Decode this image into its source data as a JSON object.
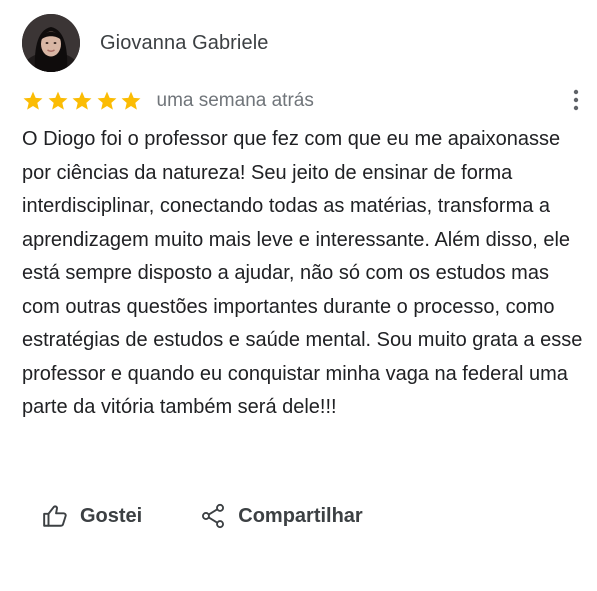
{
  "review": {
    "author": {
      "name": "Giovanna Gabriele",
      "avatar": "avatar-photo"
    },
    "rating": {
      "value": 5,
      "max": 5,
      "star_color": "#fbbc04"
    },
    "date": "uma semana atrás",
    "more_icon": "more-vert-icon",
    "text": "O Diogo foi o professor que fez com que eu me apaixonasse por ciências da natureza! Seu jeito de ensinar de forma interdisciplinar, conectando todas as matérias, transforma a aprendizagem muito mais leve e interessante. Além disso, ele está sempre disposto a ajudar, não só com os estudos mas com outras questões importantes durante o processo, como estratégias de estudos e saúde mental. Sou muito grata a esse professor e quando eu conquistar minha vaga na federal uma parte da vitória também será dele!!!"
  },
  "actions": {
    "like": {
      "label": "Gostei",
      "icon": "thumbs-up-icon"
    },
    "share": {
      "label": "Compartilhar",
      "icon": "share-icon"
    }
  }
}
